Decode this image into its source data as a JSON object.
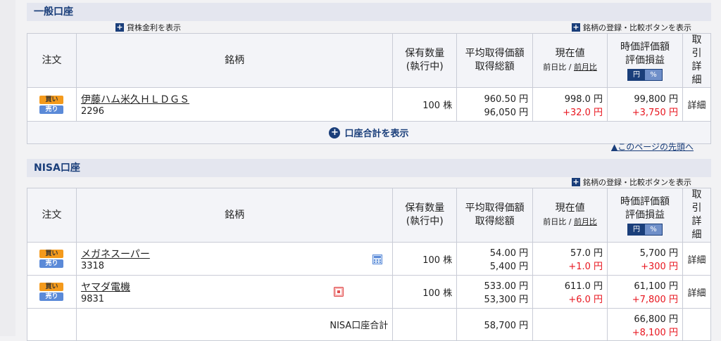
{
  "general_account": {
    "title": "一般口座",
    "show_loan_rate": "貸株金利を表示",
    "show_compare": "銘柄の登録・比較ボタンを表示",
    "headers": {
      "order": "注文",
      "stock": "銘柄",
      "qty_line1": "保有数量",
      "qty_line2": "(執行中)",
      "avg_line1": "平均取得価額",
      "avg_line2": "取得総額",
      "cur_line1": "現在値",
      "cur_sub1": "前日比",
      "cur_sep": " / ",
      "cur_sub2": "前月比",
      "val_line1": "時価評価額",
      "val_line2": "評価損益",
      "toggle_yen": "円",
      "toggle_pct": "%",
      "detail_line1": "取引",
      "detail_line2": "詳細"
    },
    "rows": [
      {
        "buy": "買い",
        "sell": "売り",
        "name": "伊藤ハム米久ＨＬＤＧＳ",
        "code": "2296",
        "qty": "100 株",
        "avg": "960.50 円",
        "total": "96,050 円",
        "price": "998.0 円",
        "change": "+32.0 円",
        "value": "99,800 円",
        "pl": "+3,750 円",
        "detail": "詳細"
      }
    ],
    "total_link": "口座合計を表示"
  },
  "page_top_link": "▲このページの先頭へ",
  "nisa_account": {
    "title": "NISA口座",
    "show_compare": "銘柄の登録・比較ボタンを表示",
    "headers": {
      "order": "注文",
      "stock": "銘柄",
      "qty_line1": "保有数量",
      "qty_line2": "(執行中)",
      "avg_line1": "平均取得価額",
      "avg_line2": "取得総額",
      "cur_line1": "現在値",
      "cur_sub1": "前日比",
      "cur_sep": " / ",
      "cur_sub2": "前月比",
      "val_line1": "時価評価額",
      "val_line2": "評価損益",
      "toggle_yen": "円",
      "toggle_pct": "%",
      "detail_line1": "取引",
      "detail_line2": "詳細"
    },
    "rows": [
      {
        "buy": "買い",
        "sell": "売り",
        "name": "メガネスーパー",
        "code": "3318",
        "qty": "100 株",
        "avg": "54.00 円",
        "total": "5,400 円",
        "price": "57.0 円",
        "change": "+1.0 円",
        "value": "5,700 円",
        "pl": "+300 円",
        "detail": "詳細"
      },
      {
        "buy": "買い",
        "sell": "売り",
        "name": "ヤマダ電機",
        "code": "9831",
        "qty": "100 株",
        "avg": "533.00 円",
        "total": "53,300 円",
        "price": "611.0 円",
        "change": "+6.0 円",
        "value": "61,100 円",
        "pl": "+7,800 円",
        "detail": "詳細"
      }
    ],
    "total_label": "NISA口座合計",
    "total_cost": "58,700 円",
    "total_value": "66,800 円",
    "total_pl": "+8,100 円"
  },
  "colors": {
    "navy": "#1a3e7a",
    "red": "#e8161f",
    "buy": "#f49a1c",
    "sell": "#5b8ad8"
  }
}
